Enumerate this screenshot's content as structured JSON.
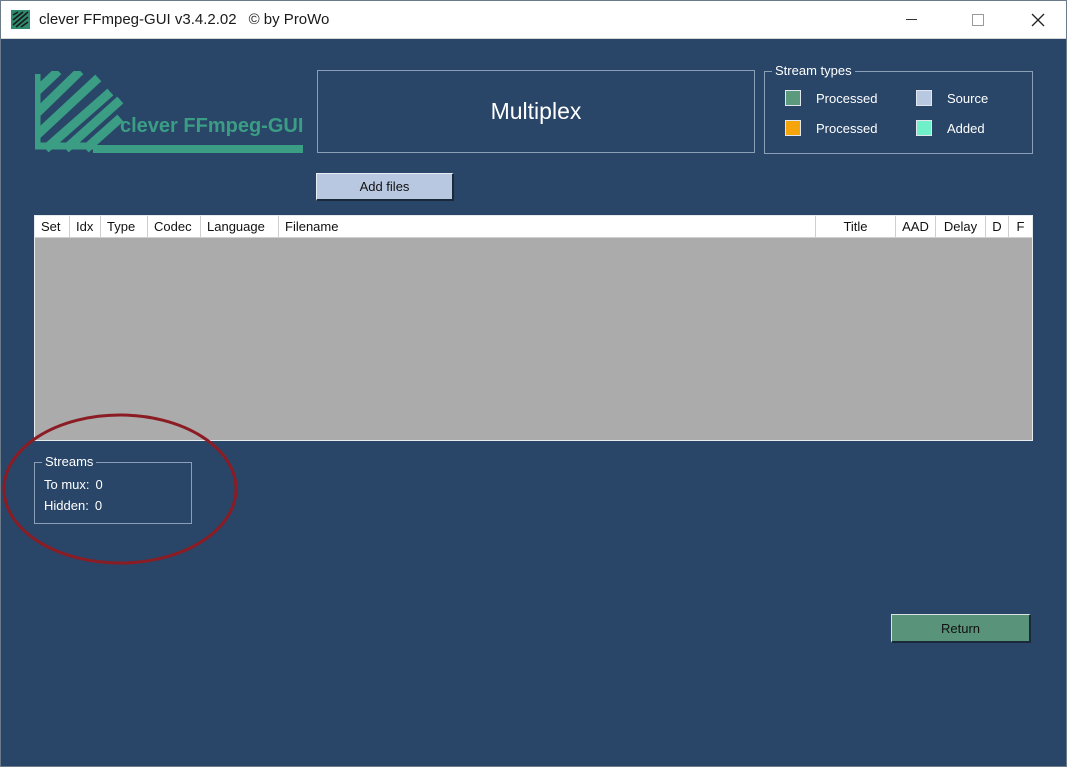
{
  "window": {
    "app_title": "clever FFmpeg-GUI v3.4.2.02",
    "copyright": "© by ProWo"
  },
  "logo": {
    "text": "clever FFmpeg-GUI"
  },
  "header": {
    "title": "Multiplex"
  },
  "stream_types": {
    "title": "Stream types",
    "items": [
      {
        "label": "Processed",
        "color": "#5b9a7c"
      },
      {
        "label": "Source",
        "color": "#b8c8e0"
      },
      {
        "label": "Processed",
        "color": "#f5a40a"
      },
      {
        "label": "Added",
        "color": "#6ff0c8"
      }
    ]
  },
  "toolbar": {
    "add_files_label": "Add files"
  },
  "table": {
    "columns": [
      "Set",
      "Idx",
      "Type",
      "Codec",
      "Language",
      "Filename",
      "Title",
      "AAD",
      "Delay",
      "D",
      "F"
    ],
    "rows": []
  },
  "streams": {
    "title": "Streams",
    "to_mux_label": "To mux:",
    "to_mux_value": "0",
    "hidden_label": "Hidden:",
    "hidden_value": "0"
  },
  "footer": {
    "return_label": "Return"
  },
  "colors": {
    "background": "#294668",
    "accent": "#3b9d84",
    "annotation": "#8c1c24"
  },
  "icons": {
    "app": "ffmpeg-logo-icon",
    "minimize": "minimize-icon",
    "maximize": "maximize-icon",
    "close": "close-icon"
  }
}
